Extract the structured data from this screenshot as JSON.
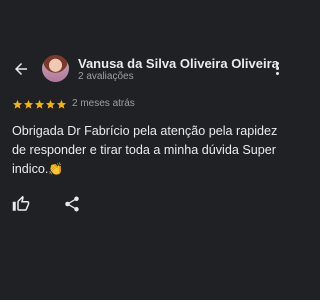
{
  "header": {
    "back_icon": "arrow-back-icon",
    "reviewer_name": "Vanusa da Silva Oliveira Oliveira",
    "review_count": "2 avaliações",
    "menu_icon": "more-vert-icon"
  },
  "review": {
    "rating": 5,
    "rating_max": 5,
    "star_color": "#f4b400",
    "date": "2 meses atrás",
    "text": "Obrigada Dr Fabrício pela atenção pela rapidez de responder e tirar toda a minha dúvida Super indico.",
    "emoji": "👏"
  },
  "actions": {
    "like_icon": "thumb-up-icon",
    "share_icon": "share-icon"
  },
  "colors": {
    "background": "#202124",
    "text_primary": "#e8eaed",
    "text_secondary": "#9aa0a6"
  }
}
